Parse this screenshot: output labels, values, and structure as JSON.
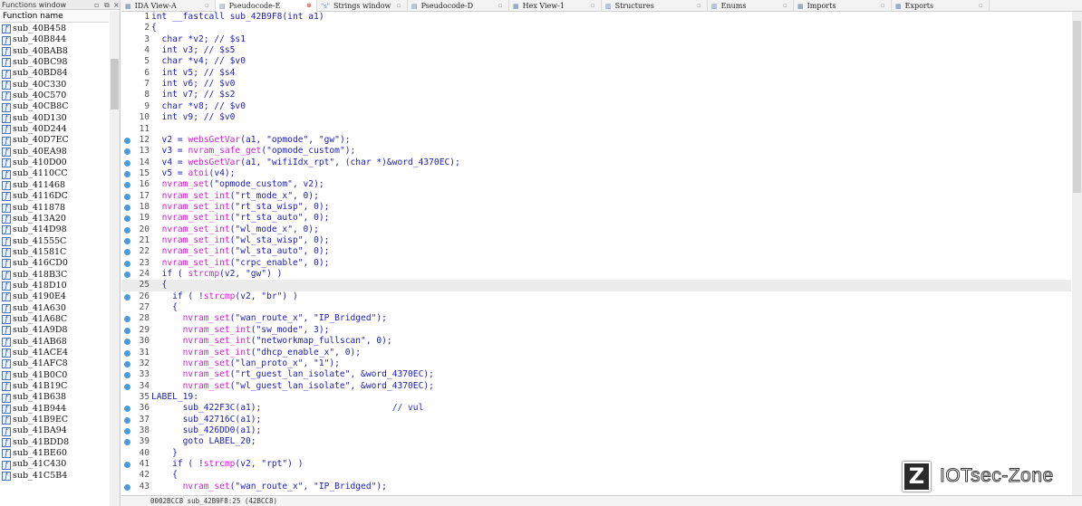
{
  "left_pane": {
    "title": "Functions window",
    "column_header": "Function name",
    "functions": [
      "sub_40B458",
      "sub_40B844",
      "sub_40BAB8",
      "sub_40BC98",
      "sub_40BD84",
      "sub_40C330",
      "sub_40C570",
      "sub_40CB8C",
      "sub_40D130",
      "sub_40D244",
      "sub_40D7EC",
      "sub_40EA98",
      "sub_410D00",
      "sub_4110CC",
      "sub_411468",
      "sub_4116DC",
      "sub_411878",
      "sub_413A20",
      "sub_414D98",
      "sub_41555C",
      "sub_41581C",
      "sub_416CD0",
      "sub_418B3C",
      "sub_418D10",
      "sub_4190E4",
      "sub_41A630",
      "sub_41A68C",
      "sub_41A9D8",
      "sub_41AB68",
      "sub_41ACE4",
      "sub_41AFC8",
      "sub_41B0C0",
      "sub_41B19C",
      "sub_41B638",
      "sub_41B944",
      "sub_41B9EC",
      "sub_41BA94",
      "sub_41BDD8",
      "sub_41BE60",
      "sub_41C430",
      "sub_41C5B4"
    ]
  },
  "tabs": [
    {
      "label": "IDA View-A",
      "active": false
    },
    {
      "label": "Pseudocode-E",
      "active": true
    },
    {
      "label": "Strings window",
      "active": false
    },
    {
      "label": "Pseudocode-D",
      "active": false
    },
    {
      "label": "Hex View-1",
      "active": false
    },
    {
      "label": "Structures",
      "active": false
    },
    {
      "label": "Enums",
      "active": false
    },
    {
      "label": "Imports",
      "active": false
    },
    {
      "label": "Exports",
      "active": false
    }
  ],
  "code_lines": [
    {
      "n": "1",
      "dot": false,
      "hl": false,
      "parts": [
        [
          "plain",
          "int __fastcall sub_42B9F8(int a1)"
        ]
      ]
    },
    {
      "n": "2",
      "dot": false,
      "hl": false,
      "parts": [
        [
          "plain",
          "{"
        ]
      ]
    },
    {
      "n": "3",
      "dot": false,
      "hl": false,
      "parts": [
        [
          "plain",
          "  char *v2; // $s1"
        ]
      ]
    },
    {
      "n": "4",
      "dot": false,
      "hl": false,
      "parts": [
        [
          "plain",
          "  int v3; // $s5"
        ]
      ]
    },
    {
      "n": "5",
      "dot": false,
      "hl": false,
      "parts": [
        [
          "plain",
          "  char *v4; // $v0"
        ]
      ]
    },
    {
      "n": "6",
      "dot": false,
      "hl": false,
      "parts": [
        [
          "plain",
          "  int v5; // $s4"
        ]
      ]
    },
    {
      "n": "7",
      "dot": false,
      "hl": false,
      "parts": [
        [
          "plain",
          "  int v6; // $v0"
        ]
      ]
    },
    {
      "n": "8",
      "dot": false,
      "hl": false,
      "parts": [
        [
          "plain",
          "  int v7; // $s2"
        ]
      ]
    },
    {
      "n": "9",
      "dot": false,
      "hl": false,
      "parts": [
        [
          "plain",
          "  char *v8; // $v0"
        ]
      ]
    },
    {
      "n": "10",
      "dot": false,
      "hl": false,
      "parts": [
        [
          "plain",
          "  int v9; // $v0"
        ]
      ]
    },
    {
      "n": "11",
      "dot": false,
      "hl": false,
      "parts": [
        [
          "plain",
          ""
        ]
      ]
    },
    {
      "n": "12",
      "dot": true,
      "hl": false,
      "parts": [
        [
          "plain",
          "  v2 = "
        ],
        [
          "fn",
          "websGetVar"
        ],
        [
          "plain",
          "(a1, \"opmode\", \"gw\");"
        ]
      ]
    },
    {
      "n": "13",
      "dot": true,
      "hl": false,
      "parts": [
        [
          "plain",
          "  v3 = "
        ],
        [
          "fn",
          "nvram_safe_get"
        ],
        [
          "plain",
          "(\"opmode_custom\");"
        ]
      ]
    },
    {
      "n": "14",
      "dot": true,
      "hl": false,
      "parts": [
        [
          "plain",
          "  v4 = "
        ],
        [
          "fn",
          "websGetVar"
        ],
        [
          "plain",
          "(a1, \"wifiIdx_rpt\", (char *)&word_4370EC);"
        ]
      ]
    },
    {
      "n": "15",
      "dot": true,
      "hl": false,
      "parts": [
        [
          "plain",
          "  v5 = "
        ],
        [
          "fn",
          "atoi"
        ],
        [
          "plain",
          "(v4);"
        ]
      ]
    },
    {
      "n": "16",
      "dot": true,
      "hl": false,
      "parts": [
        [
          "plain",
          "  "
        ],
        [
          "fn",
          "nvram_set"
        ],
        [
          "plain",
          "(\"opmode_custom\", v2);"
        ]
      ]
    },
    {
      "n": "17",
      "dot": true,
      "hl": false,
      "parts": [
        [
          "plain",
          "  "
        ],
        [
          "fn",
          "nvram_set_int"
        ],
        [
          "plain",
          "(\"rt_mode_x\", 0);"
        ]
      ]
    },
    {
      "n": "18",
      "dot": true,
      "hl": false,
      "parts": [
        [
          "plain",
          "  "
        ],
        [
          "fn",
          "nvram_set_int"
        ],
        [
          "plain",
          "(\"rt_sta_wisp\", 0);"
        ]
      ]
    },
    {
      "n": "19",
      "dot": true,
      "hl": false,
      "parts": [
        [
          "plain",
          "  "
        ],
        [
          "fn",
          "nvram_set_int"
        ],
        [
          "plain",
          "(\"rt_sta_auto\", 0);"
        ]
      ]
    },
    {
      "n": "20",
      "dot": true,
      "hl": false,
      "parts": [
        [
          "plain",
          "  "
        ],
        [
          "fn",
          "nvram_set_int"
        ],
        [
          "plain",
          "(\"wl_mode_x\", 0);"
        ]
      ]
    },
    {
      "n": "21",
      "dot": true,
      "hl": false,
      "parts": [
        [
          "plain",
          "  "
        ],
        [
          "fn",
          "nvram_set_int"
        ],
        [
          "plain",
          "(\"wl_sta_wisp\", 0);"
        ]
      ]
    },
    {
      "n": "22",
      "dot": true,
      "hl": false,
      "parts": [
        [
          "plain",
          "  "
        ],
        [
          "fn",
          "nvram_set_int"
        ],
        [
          "plain",
          "(\"wl_sta_auto\", 0);"
        ]
      ]
    },
    {
      "n": "23",
      "dot": true,
      "hl": false,
      "parts": [
        [
          "plain",
          "  "
        ],
        [
          "fn",
          "nvram_set_int"
        ],
        [
          "plain",
          "(\"crpc_enable\", 0);"
        ]
      ]
    },
    {
      "n": "24",
      "dot": true,
      "hl": false,
      "parts": [
        [
          "plain",
          "  if ( "
        ],
        [
          "fn",
          "strcmp"
        ],
        [
          "plain",
          "(v2, \"gw\") )"
        ]
      ]
    },
    {
      "n": "25",
      "dot": false,
      "hl": true,
      "parts": [
        [
          "plain",
          "  {"
        ]
      ]
    },
    {
      "n": "26",
      "dot": true,
      "hl": false,
      "parts": [
        [
          "plain",
          "    if ( !"
        ],
        [
          "fn",
          "strcmp"
        ],
        [
          "plain",
          "(v2, \"br\") )"
        ]
      ]
    },
    {
      "n": "27",
      "dot": false,
      "hl": false,
      "parts": [
        [
          "plain",
          "    {"
        ]
      ]
    },
    {
      "n": "28",
      "dot": true,
      "hl": false,
      "parts": [
        [
          "plain",
          "      "
        ],
        [
          "fn",
          "nvram_set"
        ],
        [
          "plain",
          "(\"wan_route_x\", \"IP_Bridged\");"
        ]
      ]
    },
    {
      "n": "29",
      "dot": true,
      "hl": false,
      "parts": [
        [
          "plain",
          "      "
        ],
        [
          "fn",
          "nvram_set_int"
        ],
        [
          "plain",
          "(\"sw_mode\", 3);"
        ]
      ]
    },
    {
      "n": "30",
      "dot": true,
      "hl": false,
      "parts": [
        [
          "plain",
          "      "
        ],
        [
          "fn",
          "nvram_set_int"
        ],
        [
          "plain",
          "(\"networkmap_fullscan\", 0);"
        ]
      ]
    },
    {
      "n": "31",
      "dot": true,
      "hl": false,
      "parts": [
        [
          "plain",
          "      "
        ],
        [
          "fn",
          "nvram_set_int"
        ],
        [
          "plain",
          "(\"dhcp_enable_x\", 0);"
        ]
      ]
    },
    {
      "n": "32",
      "dot": true,
      "hl": false,
      "parts": [
        [
          "plain",
          "      "
        ],
        [
          "fn",
          "nvram_set"
        ],
        [
          "plain",
          "(\"lan_proto_x\", \"1\");"
        ]
      ]
    },
    {
      "n": "33",
      "dot": true,
      "hl": false,
      "parts": [
        [
          "plain",
          "      "
        ],
        [
          "fn",
          "nvram_set"
        ],
        [
          "plain",
          "(\"rt_guest_lan_isolate\", &word_4370EC);"
        ]
      ]
    },
    {
      "n": "34",
      "dot": true,
      "hl": false,
      "parts": [
        [
          "plain",
          "      "
        ],
        [
          "fn",
          "nvram_set"
        ],
        [
          "plain",
          "(\"wl_guest_lan_isolate\", &word_4370EC);"
        ]
      ]
    },
    {
      "n": "35",
      "dot": false,
      "hl": false,
      "parts": [
        [
          "plain",
          "LABEL_19:"
        ]
      ]
    },
    {
      "n": "36",
      "dot": true,
      "hl": false,
      "parts": [
        [
          "plain",
          "      sub_422F3C(a1);                         "
        ],
        [
          "cmt",
          "// vul"
        ]
      ]
    },
    {
      "n": "37",
      "dot": true,
      "hl": false,
      "parts": [
        [
          "plain",
          "      sub_42716C(a1);"
        ]
      ]
    },
    {
      "n": "38",
      "dot": true,
      "hl": false,
      "parts": [
        [
          "plain",
          "      sub_426DD0(a1);"
        ]
      ]
    },
    {
      "n": "39",
      "dot": true,
      "hl": false,
      "parts": [
        [
          "plain",
          "      goto LABEL_20;"
        ]
      ]
    },
    {
      "n": "40",
      "dot": false,
      "hl": false,
      "parts": [
        [
          "plain",
          "    }"
        ]
      ]
    },
    {
      "n": "41",
      "dot": true,
      "hl": false,
      "parts": [
        [
          "plain",
          "    if ( !"
        ],
        [
          "fn",
          "strcmp"
        ],
        [
          "plain",
          "(v2, \"rpt\") )"
        ]
      ]
    },
    {
      "n": "42",
      "dot": false,
      "hl": false,
      "parts": [
        [
          "plain",
          "    {"
        ]
      ]
    },
    {
      "n": "43",
      "dot": true,
      "hl": false,
      "parts": [
        [
          "plain",
          "      "
        ],
        [
          "fn",
          "nvram_set"
        ],
        [
          "plain",
          "(\"wan_route_x\", \"IP_Bridged\");"
        ]
      ]
    }
  ],
  "status_bar": "0002BCC8 sub_42B9F8:25 (42BCC8)",
  "watermark": {
    "logo_letter": "Z",
    "text": "IOTsec-Zone"
  },
  "colors": {
    "function_call": "#d21ed2",
    "code_text": "#1b1bb4",
    "breakpoint_dot": "#4a9bd9",
    "highlight_line": "#ececec"
  }
}
